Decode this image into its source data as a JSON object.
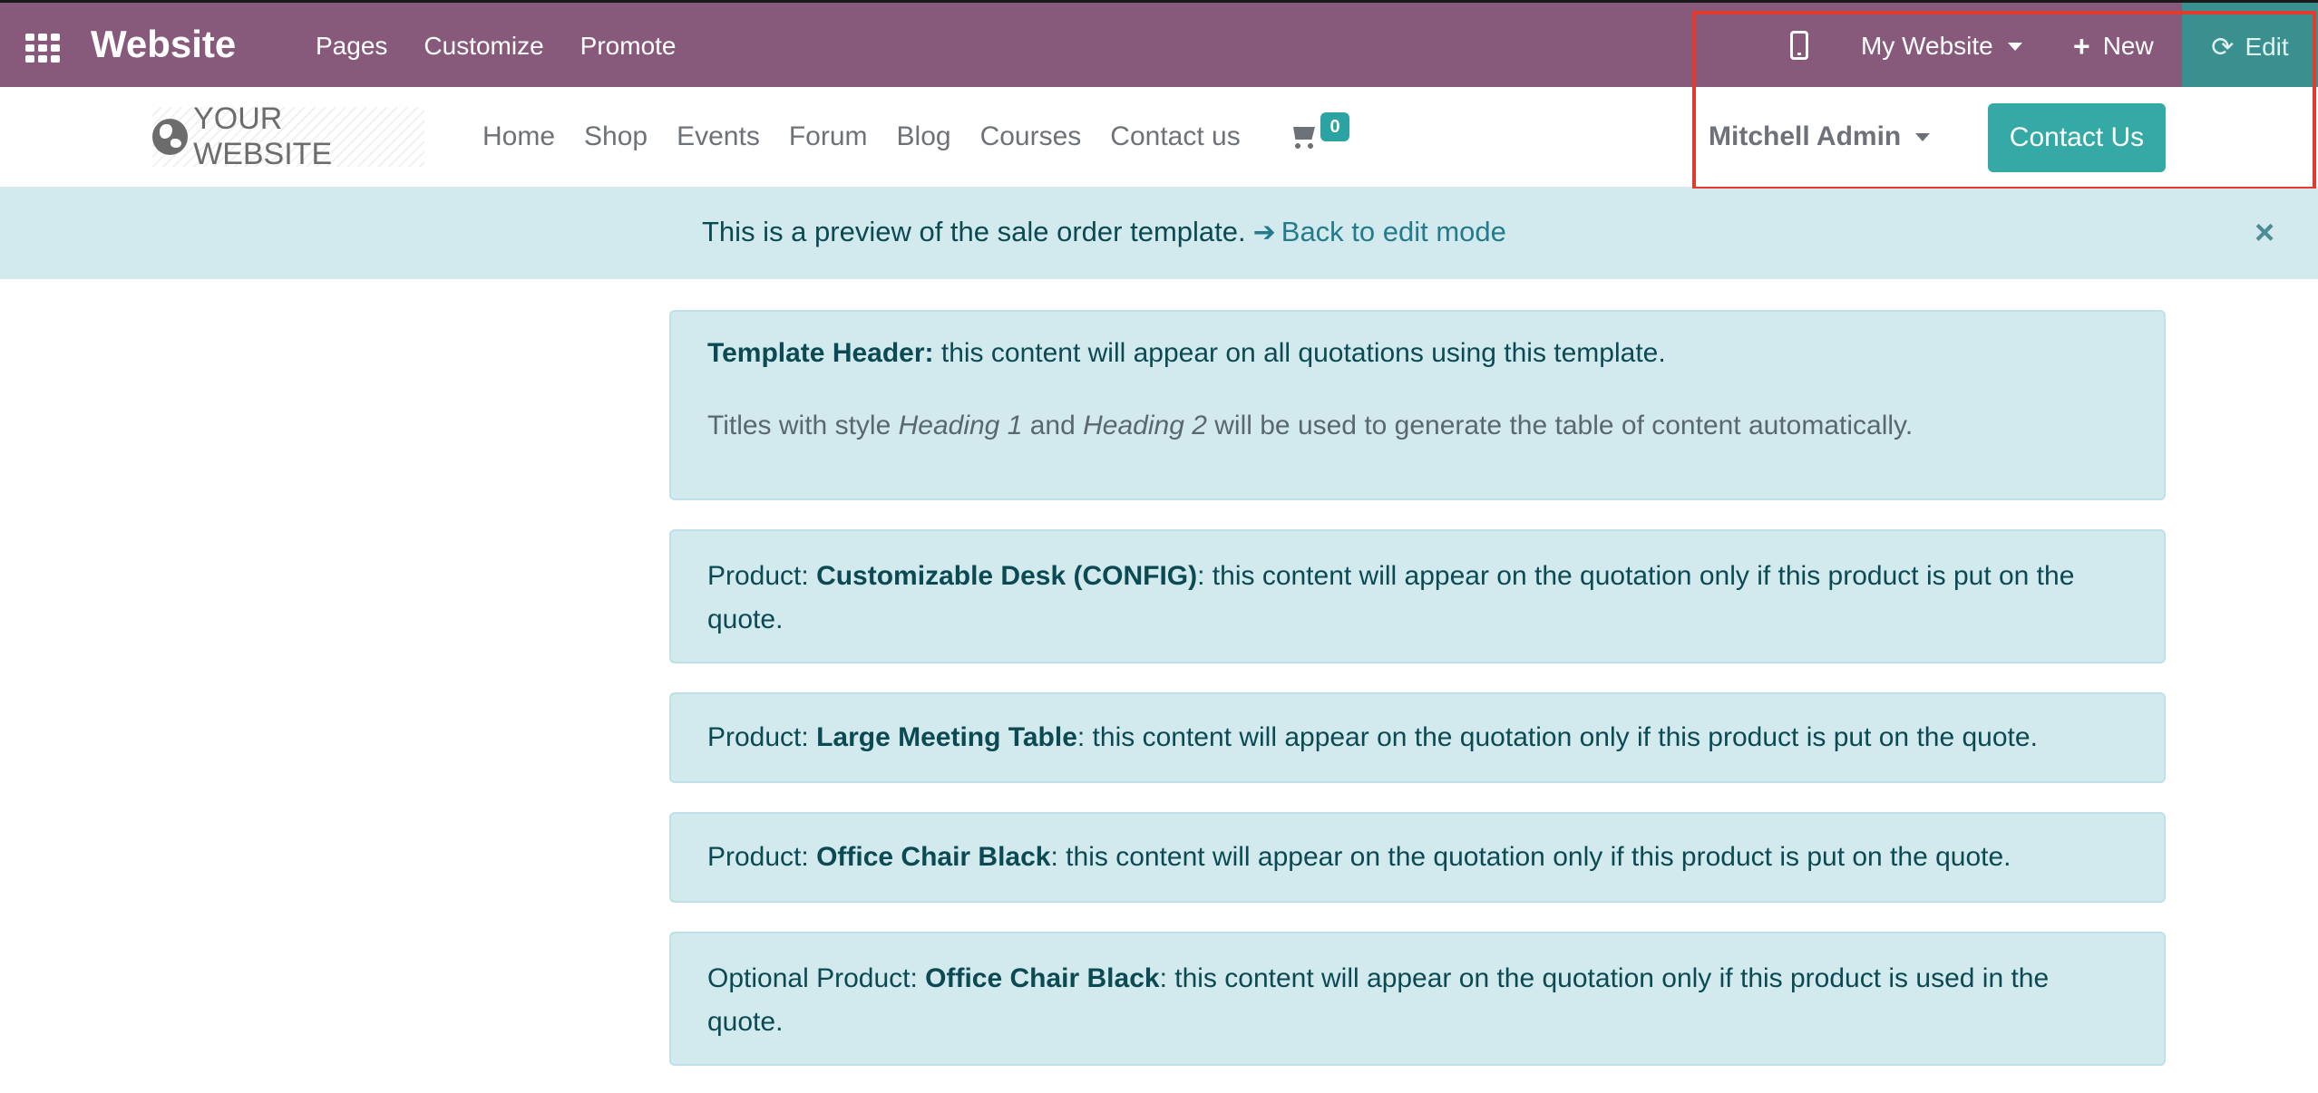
{
  "adminbar": {
    "brand": "Website",
    "menu": [
      "Pages",
      "Customize",
      "Promote"
    ],
    "website_selector": "My Website",
    "new_label": "New",
    "edit_label": "Edit",
    "icons": [
      "apps-grid-icon",
      "mobile-preview-icon",
      "plus-icon",
      "refresh-icon"
    ]
  },
  "site_header": {
    "logo_text": "YOUR WEBSITE",
    "menu": [
      "Home",
      "Shop",
      "Events",
      "Forum",
      "Blog",
      "Courses",
      "Contact us"
    ],
    "cart_count": "0",
    "user": "Mitchell Admin",
    "contact_button": "Contact Us"
  },
  "preview_banner": {
    "text": "This is a preview of the sale order template.",
    "link": "Back to edit mode",
    "close": "×"
  },
  "cards": {
    "header": {
      "label": "Template Header:",
      "text": " this content will appear on all quotations using this template.",
      "line2_a": "Titles with style ",
      "line2_h1": "Heading 1",
      "line2_b": " and ",
      "line2_h2": "Heading 2",
      "line2_c": " will be used to generate the table of content automatically."
    },
    "products": [
      {
        "prefix": "Product: ",
        "name": "Customizable Desk (CONFIG)",
        "text": ": this content will appear on the quotation only if this product is put on the quote."
      },
      {
        "prefix": "Product: ",
        "name": "Large Meeting Table",
        "text": ": this content will appear on the quotation only if this product is put on the quote."
      },
      {
        "prefix": "Product: ",
        "name": "Office Chair Black",
        "text": ": this content will appear on the quotation only if this product is put on the quote."
      },
      {
        "prefix": "Optional Product: ",
        "name": "Office Chair Black",
        "text": ": this content will appear on the quotation only if this product is used in the quote."
      }
    ]
  },
  "colors": {
    "adminbar": "#875a7b",
    "edit_button": "#3a8f8f",
    "primary": "#35a9a5",
    "banner": "#d2eaee",
    "highlight": "#e23a2c"
  }
}
